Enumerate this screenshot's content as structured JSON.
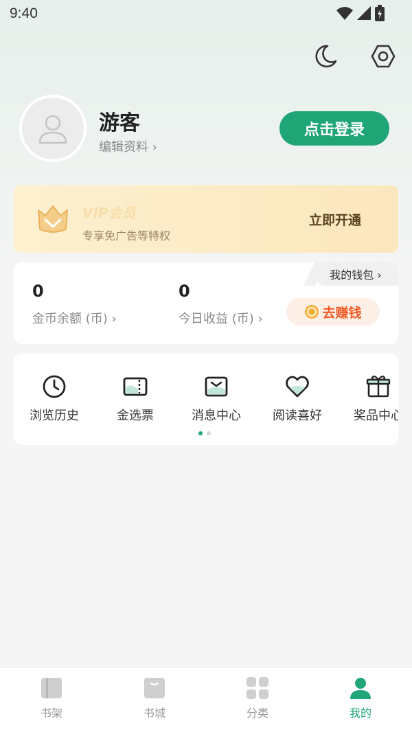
{
  "status_bar": {
    "time": "9:40"
  },
  "profile": {
    "username": "游客",
    "edit_profile": "编辑资料 ›",
    "login_button": "点击登录"
  },
  "vip": {
    "title": "VIP会员",
    "subtitle": "专享免广告等特权",
    "open_button": "立即开通"
  },
  "wallet": {
    "tab_label": "我的钱包 ›",
    "items": [
      {
        "value": "0",
        "label": "金币余额 (币) ›"
      },
      {
        "value": "0",
        "label": "今日收益 (币) ›"
      }
    ],
    "earn_button": "去赚钱"
  },
  "shortcuts": [
    {
      "label": "浏览历史",
      "icon": "clock-icon"
    },
    {
      "label": "金选票",
      "icon": "ticket-icon"
    },
    {
      "label": "消息中心",
      "icon": "message-icon"
    },
    {
      "label": "阅读喜好",
      "icon": "heart-icon"
    },
    {
      "label": "奖品中心",
      "icon": "gift-icon"
    }
  ],
  "tabbar": [
    {
      "label": "书架",
      "icon": "bookshelf-icon"
    },
    {
      "label": "书城",
      "icon": "bookstore-icon"
    },
    {
      "label": "分类",
      "icon": "category-icon"
    },
    {
      "label": "我的",
      "icon": "profile-icon",
      "active": true
    }
  ],
  "colors": {
    "accent": "#1fa576",
    "vip_text": "#5b4320",
    "earn_text": "#f15a24",
    "inactive_tab": "#999999"
  }
}
